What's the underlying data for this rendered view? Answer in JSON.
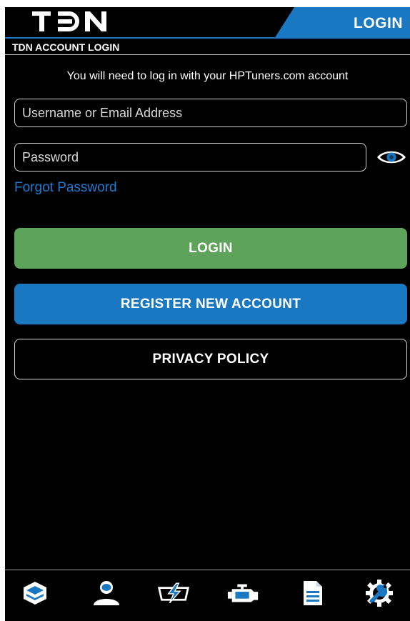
{
  "header": {
    "logo_text": "TDN",
    "login_tab_label": "LOGIN",
    "accent_color": "#1a78c2"
  },
  "section": {
    "title": "TDN ACCOUNT LOGIN"
  },
  "login_form": {
    "info_text": "You will need to log in with your HPTuners.com account",
    "username_placeholder": "Username or Email Address",
    "password_placeholder": "Password",
    "forgot_password_label": "Forgot Password",
    "login_button_label": "LOGIN",
    "register_button_label": "REGISTER NEW ACCOUNT",
    "privacy_button_label": "PRIVACY POLICY"
  },
  "colors": {
    "login_green": "#5ea35a",
    "register_blue": "#1a78c2",
    "link_blue": "#1e7bd4"
  },
  "bottom_nav": {
    "items": [
      {
        "icon": "layers-icon"
      },
      {
        "icon": "user-icon"
      },
      {
        "icon": "lightning-icon"
      },
      {
        "icon": "engine-icon"
      },
      {
        "icon": "document-icon"
      },
      {
        "icon": "settings-wrench-icon"
      }
    ]
  }
}
